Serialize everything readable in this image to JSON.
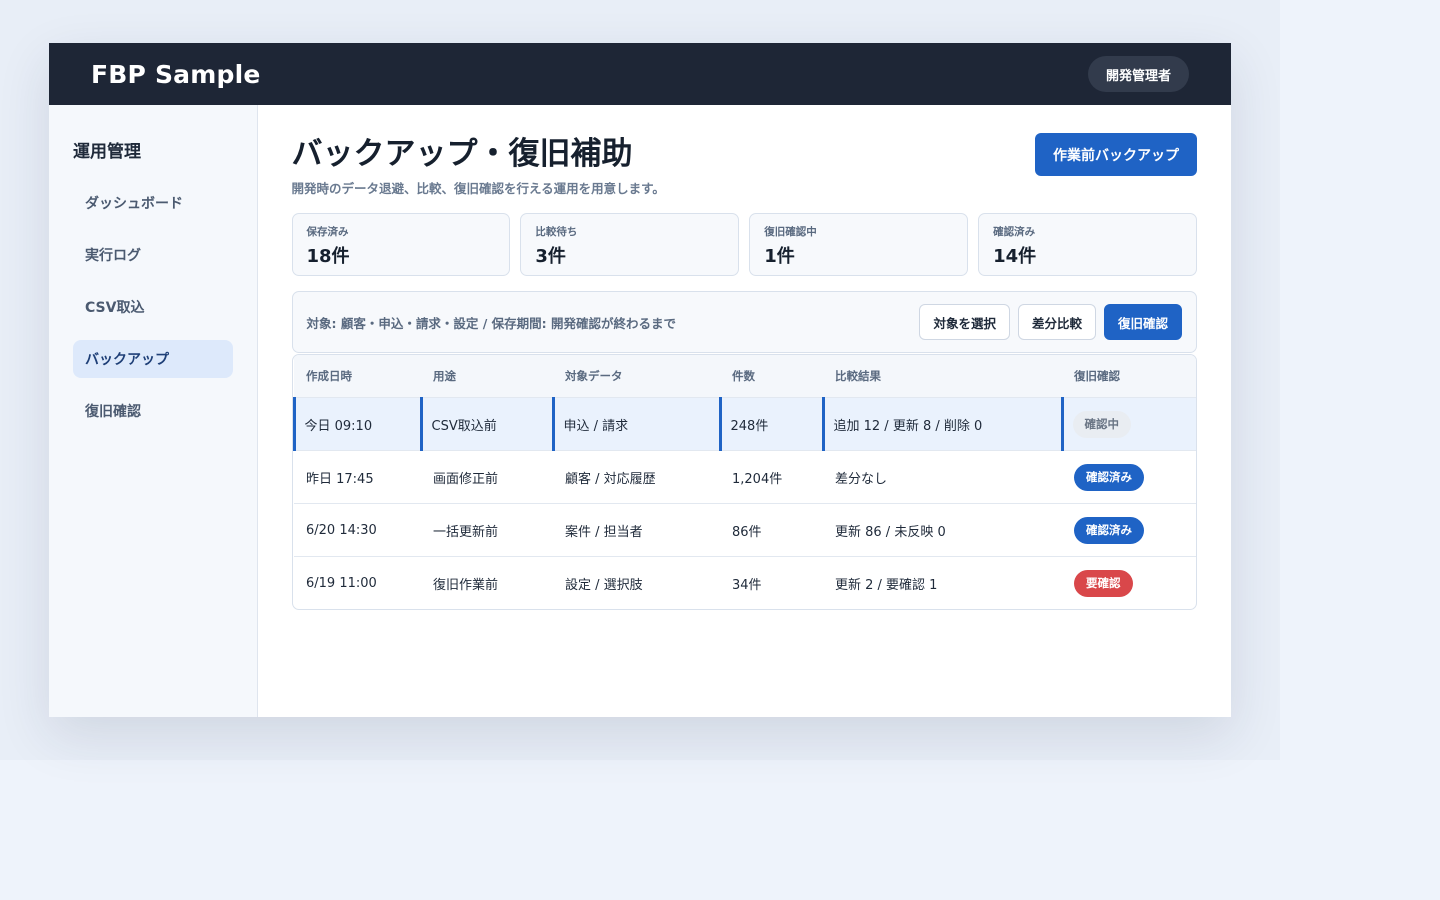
{
  "app": {
    "title": "FBP Sample",
    "user_label": "開発管理者"
  },
  "sidebar": {
    "heading": "運用管理",
    "items": [
      {
        "label": "ダッシュボード",
        "active": false
      },
      {
        "label": "実行ログ",
        "active": false
      },
      {
        "label": "CSV取込",
        "active": false
      },
      {
        "label": "バックアップ",
        "active": true
      },
      {
        "label": "復旧確認",
        "active": false
      }
    ]
  },
  "page": {
    "title": "バックアップ・復旧補助",
    "subtitle": "開発時のデータ退避、比較、復旧確認を行える運用を用意します。",
    "primary_action": "作業前バックアップ"
  },
  "stats": [
    {
      "label": "保存済み",
      "value": "18件"
    },
    {
      "label": "比較待ち",
      "value": "3件"
    },
    {
      "label": "復旧確認中",
      "value": "1件"
    },
    {
      "label": "確認済み",
      "value": "14件"
    }
  ],
  "filter": {
    "text": "対象: 顧客・申込・請求・設定 / 保存期間: 開発確認が終わるまで",
    "actions": {
      "select": "対象を選択",
      "compare": "差分比較",
      "restore": "復旧確認"
    }
  },
  "table": {
    "columns": [
      "作成日時",
      "用途",
      "対象データ",
      "件数",
      "比較結果",
      "復旧確認"
    ],
    "rows": [
      {
        "created": "今日 09:10",
        "purpose": "CSV取込前",
        "target": "申込 / 請求",
        "count": "248件",
        "result": "追加 12 / 更新 8 / 削除 0",
        "status": "確認中",
        "status_color": "gray",
        "selected": true
      },
      {
        "created": "昨日 17:45",
        "purpose": "画面修正前",
        "target": "顧客 / 対応履歴",
        "count": "1,204件",
        "result": "差分なし",
        "status": "確認済み",
        "status_color": "blue",
        "selected": false
      },
      {
        "created": "6/20 14:30",
        "purpose": "一括更新前",
        "target": "案件 / 担当者",
        "count": "86件",
        "result": "更新 86 / 未反映 0",
        "status": "確認済み",
        "status_color": "blue",
        "selected": false
      },
      {
        "created": "6/19 11:00",
        "purpose": "復旧作業前",
        "target": "設定 / 選択肢",
        "count": "34件",
        "result": "更新 2 / 要確認 1",
        "status": "要確認",
        "status_color": "red",
        "selected": false
      }
    ]
  },
  "colors": {
    "accent": "#1f63c5",
    "topbar": "#1e2636",
    "danger": "#d9474a",
    "selected_row": "#eaf2fd"
  }
}
